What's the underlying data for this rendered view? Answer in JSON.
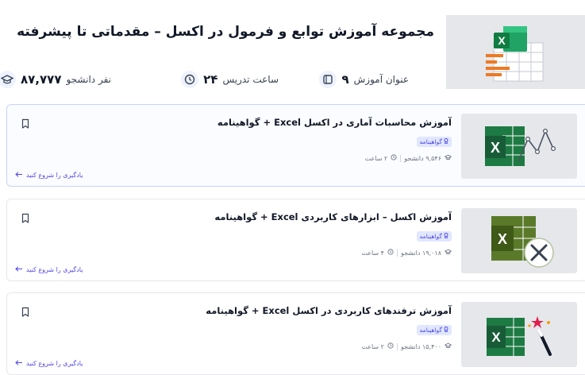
{
  "header": {
    "title": "مجموعه آموزش توابع و فرمول در اکسل – مقدماتی تا پیشرفته",
    "stats": [
      {
        "value": "۹",
        "label": "عنوان آموزش",
        "icon": "book-icon"
      },
      {
        "value": "۲۴",
        "label": "ساعت تدریس",
        "icon": "clock-icon"
      },
      {
        "value": "۸۷,۷۷۷",
        "label": "نفر دانشجو",
        "icon": "graduation-cap-icon"
      }
    ]
  },
  "courses": [
    {
      "title": "آموزش محاسبات آماری در اکسل Excel + گواهینامه",
      "badge": "گواهینامه",
      "students": "۹,۵۴۶ دانشجو",
      "duration": "۲ ساعت",
      "cta": "یادگیری را شروع کنید",
      "thumb_icon": "excel-chart-icon"
    },
    {
      "title": "آموزش اکسل – ابزارهای کاربردی Excel + گواهینامه",
      "badge": "گواهینامه",
      "students": "۱۹,۰۱۸ دانشجو",
      "duration": "۴ ساعت",
      "cta": "یادگیری را شروع کنید",
      "thumb_icon": "excel-tools-icon"
    },
    {
      "title": "آموزش ترفندهای کاربردی در اکسل Excel + گواهینامه",
      "badge": "گواهینامه",
      "students": "۱۵,۴۰۰ دانشجو",
      "duration": "۲ ساعت",
      "cta": "یادگیری را شروع کنید",
      "thumb_icon": "excel-magic-icon"
    }
  ],
  "colors": {
    "accent": "#4f46e5",
    "excel_green": "#1d7a43",
    "thumb_bg": "#e5e7eb"
  }
}
